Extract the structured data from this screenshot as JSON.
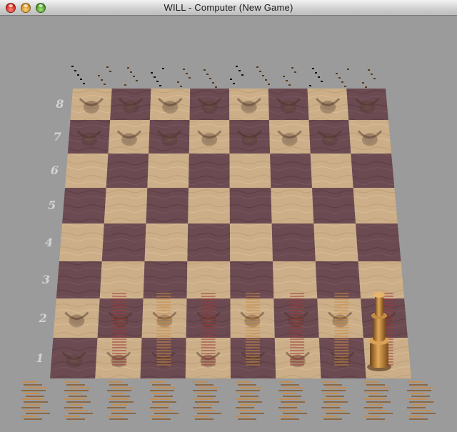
{
  "window": {
    "title": "WILL  - Computer   (New Game)"
  },
  "board": {
    "ranks": [
      "8",
      "7",
      "6",
      "5",
      "4",
      "3",
      "2",
      "1"
    ],
    "light_square_color": "#c9ac86",
    "dark_square_color": "#6e4c52"
  },
  "icons": {
    "close": "close-button",
    "minimize": "minimize-button",
    "zoom": "zoom-button"
  }
}
